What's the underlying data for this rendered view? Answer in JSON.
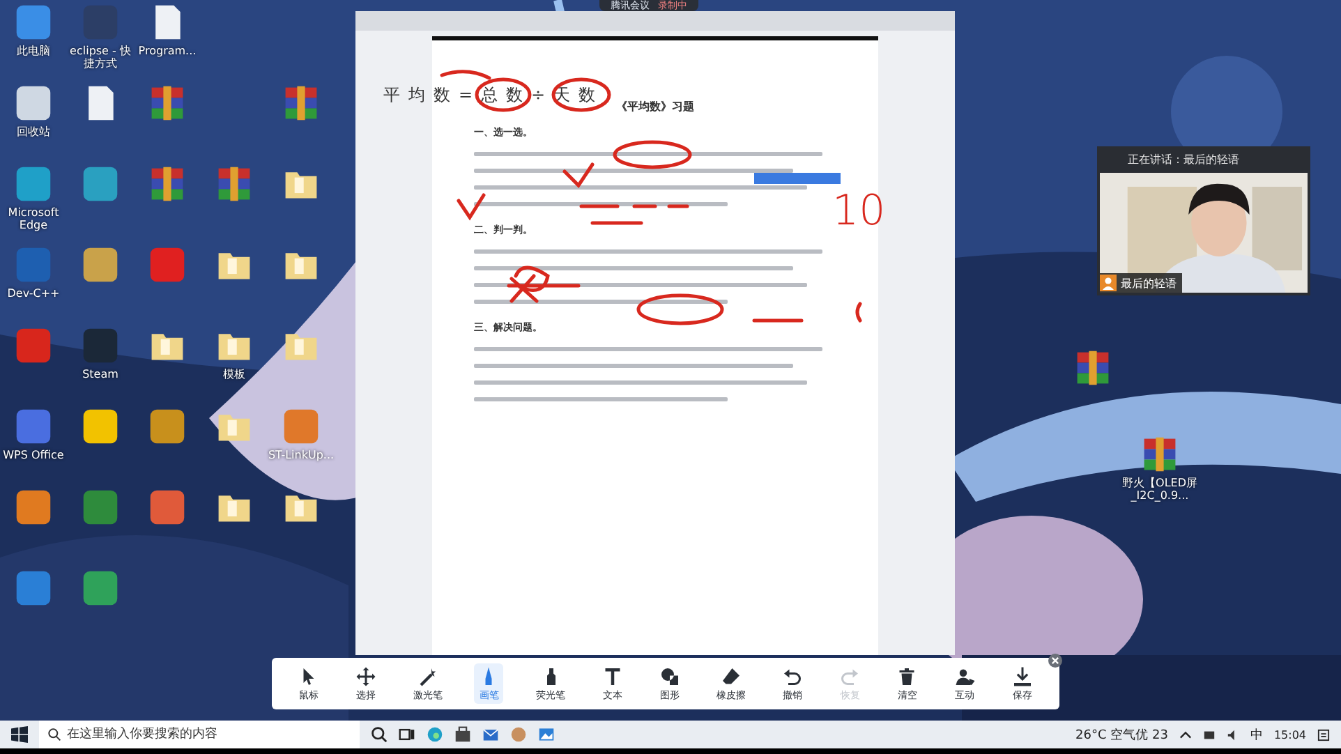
{
  "meeting_bar": {
    "app": "腾讯会议",
    "status": "录制中"
  },
  "desktop_icons": [
    {
      "kind": "app",
      "color": "#3a8ee6",
      "label": "此电脑"
    },
    {
      "kind": "app",
      "color": "#cfd8e3",
      "label": "回收站"
    },
    {
      "kind": "app",
      "color": "#1fa0c8",
      "label": "Microsoft Edge"
    },
    {
      "kind": "app",
      "color": "#1e5fb0",
      "label": "Dev-C++"
    },
    {
      "kind": "app",
      "color": "#d8261c"
    },
    {
      "kind": "app",
      "color": "#4a6ee0",
      "label": "WPS Office"
    },
    {
      "kind": "app",
      "color": "#e07a20"
    },
    {
      "kind": "app",
      "color": "#2a7fd6"
    },
    {
      "kind": "app",
      "color": "#2c3e66",
      "label": "eclipse - 快捷方式"
    },
    {
      "kind": "document"
    },
    {
      "kind": "app",
      "color": "#2aa0c0"
    },
    {
      "kind": "app",
      "color": "#c9a24a"
    },
    {
      "kind": "app",
      "color": "#1b2838",
      "label": "Steam"
    },
    {
      "kind": "app",
      "color": "#f2c200"
    },
    {
      "kind": "app",
      "color": "#2e8b3c"
    },
    {
      "kind": "app",
      "color": "#2fa25a"
    },
    {
      "kind": "document",
      "label": "Program..."
    },
    {
      "kind": "archive"
    },
    {
      "kind": "archive"
    },
    {
      "kind": "app",
      "color": "#e02020"
    },
    {
      "kind": "folder"
    },
    {
      "kind": "app",
      "color": "#c8901c"
    },
    {
      "kind": "app",
      "color": "#e05a3a"
    },
    {
      "kind": "empty"
    },
    {
      "kind": "empty"
    },
    {
      "kind": "empty"
    },
    {
      "kind": "archive"
    },
    {
      "kind": "folder"
    },
    {
      "kind": "folder",
      "label": "模板"
    },
    {
      "kind": "folder"
    },
    {
      "kind": "folder"
    },
    {
      "kind": "empty"
    },
    {
      "kind": "empty"
    },
    {
      "kind": "archive"
    },
    {
      "kind": "folder"
    },
    {
      "kind": "folder"
    },
    {
      "kind": "folder"
    },
    {
      "kind": "app",
      "color": "#e0782a",
      "label": "ST-LinkUp..."
    },
    {
      "kind": "folder"
    },
    {
      "kind": "empty"
    }
  ],
  "right_icons": [
    {
      "kind": "archive"
    },
    {
      "kind": "archive",
      "label": "野火【OLED屏_I2C_0.9..."
    }
  ],
  "document": {
    "heading": "平均数=总数÷天数",
    "title": "《平均数》习题",
    "sections": [
      {
        "title": "一、选一选。"
      },
      {
        "title": "二、判一判。"
      },
      {
        "title": "三、解决问题。"
      }
    ],
    "handwriting": "10"
  },
  "video": {
    "speaking": "正在讲话：最后的轻语",
    "name": "最后的轻语"
  },
  "toolbar": [
    {
      "kind": "pointer",
      "label": "鼠标",
      "selected": false,
      "disabled": false
    },
    {
      "kind": "move",
      "label": "选择",
      "selected": false,
      "disabled": false
    },
    {
      "kind": "laser",
      "label": "激光笔",
      "selected": false,
      "disabled": false
    },
    {
      "kind": "pen",
      "label": "画笔",
      "selected": true,
      "disabled": false
    },
    {
      "kind": "highlighter",
      "label": "荧光笔",
      "selected": false,
      "disabled": false
    },
    {
      "kind": "text",
      "label": "文本",
      "selected": false,
      "disabled": false
    },
    {
      "kind": "shape",
      "label": "图形",
      "selected": false,
      "disabled": false
    },
    {
      "kind": "eraser",
      "label": "橡皮擦",
      "selected": false,
      "disabled": false
    },
    {
      "kind": "undo",
      "label": "撤销",
      "selected": false,
      "disabled": false
    },
    {
      "kind": "redo",
      "label": "恢复",
      "selected": false,
      "disabled": true
    },
    {
      "kind": "trash",
      "label": "清空",
      "selected": false,
      "disabled": false
    },
    {
      "kind": "people",
      "label": "互动",
      "selected": false,
      "disabled": false
    },
    {
      "kind": "download",
      "label": "保存",
      "selected": false,
      "disabled": false
    }
  ],
  "taskbar": {
    "placeholder": "在这里输入你要搜索的内容",
    "weather": "26°C 空气优 23",
    "ime": "中",
    "time": "15:04"
  }
}
